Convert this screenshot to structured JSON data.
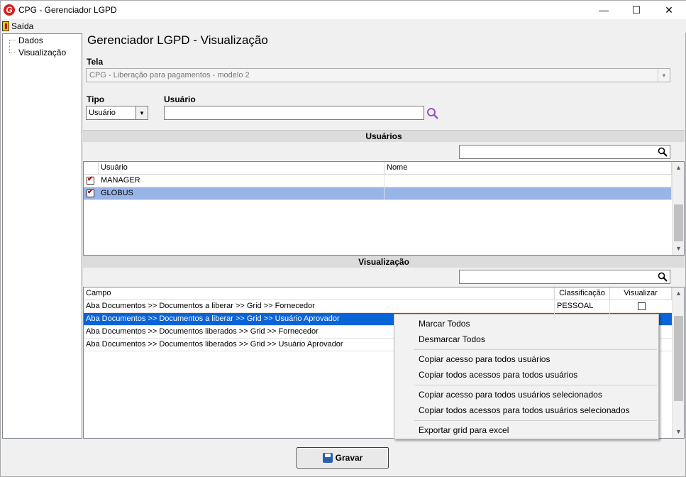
{
  "window": {
    "title": "CPG - Gerenciador LGPD",
    "minimize_glyph": "—",
    "maximize_glyph": "☐",
    "close_glyph": "✕"
  },
  "menu": {
    "exit_label": "Saída"
  },
  "tree": {
    "items": [
      "Dados",
      "Visualização"
    ]
  },
  "page": {
    "title": "Gerenciador LGPD - Visualização"
  },
  "form": {
    "tela_label": "Tela",
    "tela_value": "CPG - Liberação para pagamentos - modelo 2",
    "tipo_label": "Tipo",
    "tipo_value": "Usuário",
    "usuario_label": "Usuário",
    "usuario_value": ""
  },
  "usuarios_section": {
    "title": "Usuários",
    "search_value": "",
    "columns": [
      "Usuário",
      "Nome"
    ],
    "rows": [
      {
        "checked": true,
        "usuario": "MANAGER",
        "nome": ""
      },
      {
        "checked": true,
        "usuario": "GLOBUS",
        "nome": ""
      }
    ]
  },
  "visualizacao_section": {
    "title": "Visualização",
    "search_value": "",
    "columns": [
      "Campo",
      "Classificação",
      "Visualizar"
    ],
    "rows": [
      {
        "campo": "Aba Documentos >> Documentos a liberar >> Grid >> Fornecedor",
        "classificacao": "PESSOAL",
        "visualizar": false
      },
      {
        "campo": "Aba Documentos >> Documentos a liberar >> Grid >> Usuário Aprovador",
        "classificacao": "",
        "visualizar": false
      },
      {
        "campo": "Aba Documentos >> Documentos liberados >> Grid >> Fornecedor",
        "classificacao": "",
        "visualizar": false
      },
      {
        "campo": "Aba Documentos >> Documentos liberados >> Grid >> Usuário Aprovador",
        "classificacao": "",
        "visualizar": false
      }
    ]
  },
  "context_menu": {
    "items": [
      "Marcar Todos",
      "Desmarcar Todos",
      "Copiar acesso para todos usuários",
      "Copiar todos acessos para todos usuários",
      "Copiar acesso para todos usuários selecionados",
      "Copiar todos acessos para todos usuários selecionados",
      "Exportar grid para excel"
    ]
  },
  "footer": {
    "save_label": "Gravar"
  },
  "icons": {
    "app": "app-logo-icon",
    "exit": "exit-door-icon",
    "search": "search-icon",
    "lookup": "magnifier-lookup-icon",
    "save": "floppy-disk-icon"
  },
  "colors": {
    "selected_row_light": "#99b4e6",
    "selected_row_dark": "#0a64d7",
    "lookup_icon": "#9b4fc9",
    "check_mark": "#c00000"
  }
}
